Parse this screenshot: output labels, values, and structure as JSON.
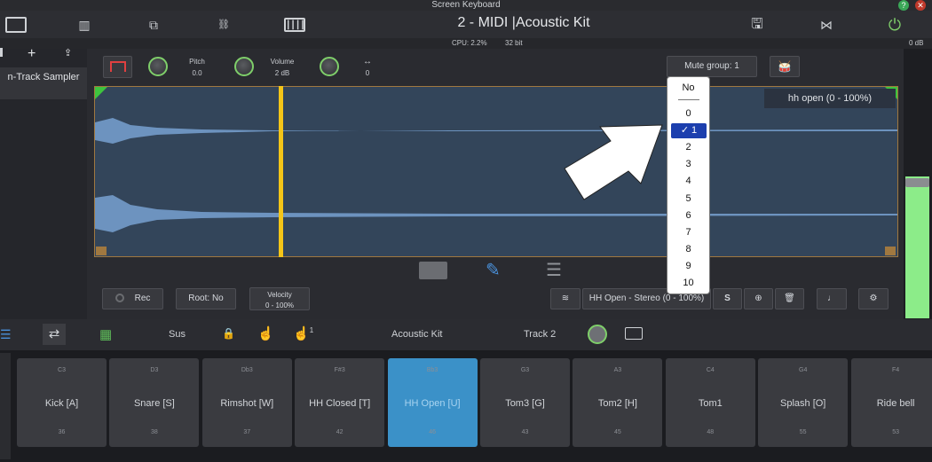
{
  "window_title": "Screen Keyboard",
  "track_title": "2 - MIDI |Acoustic Kit",
  "status": {
    "cpu": "CPU: 2.2%",
    "bits": "32 bit",
    "db": "0 dB"
  },
  "sidebar": {
    "add_label": "+",
    "instrument_label": "n-Track Sampler"
  },
  "controls": {
    "pitch_label": "Pitch",
    "pitch_value": "0.0",
    "volume_label": "Volume",
    "volume_value": "2 dB",
    "pan_icon": "↔",
    "pan_value": "0",
    "mute_group_label": "Mute group: 1"
  },
  "waveform": {
    "sample_label": "hh open (0 - 100%)",
    "playhead_fraction": 0.23
  },
  "mute_menu": {
    "header": "No",
    "options": [
      "0",
      "1",
      "2",
      "3",
      "4",
      "5",
      "6",
      "7",
      "8",
      "9",
      "10"
    ],
    "selected": "1",
    "check": "✓"
  },
  "bottom_controls": {
    "rec_label": "Rec",
    "root_label": "Root: No",
    "velocity_label": "Velocity",
    "velocity_value": "0 - 100%",
    "layer_label": "HH Open - Stereo (0 - 100%)",
    "s_label": "S"
  },
  "padsbar": {
    "sus_label": "Sus",
    "kit_label": "Acoustic Kit",
    "track_label": "Track 2",
    "latch_sup": "1"
  },
  "pads": [
    {
      "note": "C3",
      "name": "Kick [A]",
      "num": "36"
    },
    {
      "note": "D3",
      "name": "Snare [S]",
      "num": "38"
    },
    {
      "note": "Db3",
      "name": "Rimshot [W]",
      "num": "37"
    },
    {
      "note": "F#3",
      "name": "HH Closed [T]",
      "num": "42"
    },
    {
      "note": "Bb3",
      "name": "HH Open [U]",
      "num": "46",
      "active": true
    },
    {
      "note": "G3",
      "name": "Tom3 [G]",
      "num": "43"
    },
    {
      "note": "A3",
      "name": "Tom2 [H]",
      "num": "45"
    },
    {
      "note": "C4",
      "name": "Tom1",
      "num": "48"
    },
    {
      "note": "G4",
      "name": "Splash [O]",
      "num": "55"
    },
    {
      "note": "F4",
      "name": "Ride bell",
      "num": "53"
    }
  ],
  "colors": {
    "accent_green": "#7fcf6a",
    "playhead": "#f5c518",
    "pad_active": "#3b91c8",
    "menu_selected": "#1c3fae"
  }
}
